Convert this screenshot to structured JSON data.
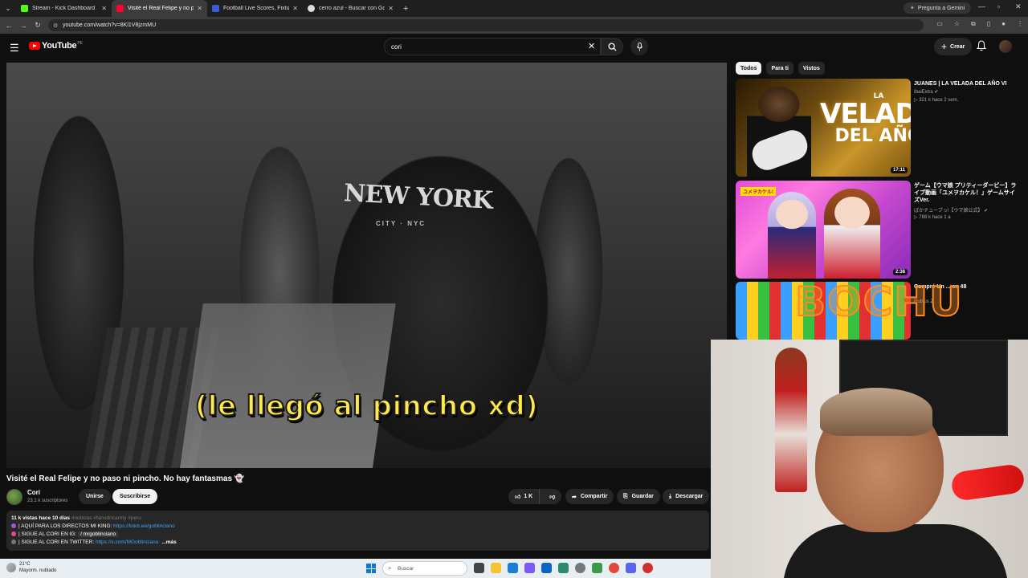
{
  "browser": {
    "tabs": [
      {
        "title": "Stream - Kick Dashboard",
        "favicon_color": "#53fc18",
        "active": false
      },
      {
        "title": "Visité el Real Felipe y no paso n",
        "favicon_color": "#ff0033",
        "active": true
      },
      {
        "title": "Football Live Scores, Fixtures &",
        "favicon_color": "#3b5bdb",
        "active": false
      },
      {
        "title": "cerro azul - Buscar con Google",
        "favicon_color": "#dddddd",
        "active": false
      }
    ],
    "gemini_label": "Pregunta a Gemini",
    "url": "youtube.com/watch?v=8Kl1V8jzmMU"
  },
  "youtube": {
    "logo_text": "YouTube",
    "country_code": "PE",
    "search_value": "cori",
    "create_label": "Crear"
  },
  "video": {
    "subtitle_overlay": "(le llegó al pincho xd)",
    "shirt_text": "NEW YORK",
    "shirt_subtext": "CITY · NYC",
    "title": "Visité el Real Felipe y no paso ni pincho. No hay fantasmas 👻",
    "channel": "Cori",
    "subscribers": "23.1 k suscriptores",
    "join_label": "Unirse",
    "subscribe_label": "Suscribirse",
    "likes": "1 K",
    "share_label": "Compartir",
    "save_label": "Guardar",
    "download_label": "Descargar",
    "description": {
      "meta": "11 k vistas  hace 10 días",
      "tags": "#noticias #fanodricarmy #peru",
      "line1_text": "| AQUÍ PARA LOS DIRECTOS MI KING: ",
      "line1_link": "https://linktr.ee/goblinciano",
      "line2_text": "| SIGUE AL CORI EN IG: ",
      "line2_chip": "/ mrgoblinciano",
      "line3_text": "| SIGUE AL CORI EN TWITTER: ",
      "line3_link": "https://x.com/MGoblinciano",
      "more_label": "...más"
    }
  },
  "sidebar": {
    "chips": [
      "Todos",
      "Para ti",
      "Vistos"
    ],
    "recommendations": [
      {
        "title": "JUANES | LA VELADA DEL AÑO VI",
        "channel": "IbaiExtra",
        "stats": "321 k  hace 2 sem.",
        "duration": "17:11",
        "thumb_text_top": "LA",
        "thumb_text_mid": "VELADA",
        "thumb_text_bot": "DEL AÑO"
      },
      {
        "title": "ゲーム【ウマ娘 プリティーダービー】ライブ動画「ユメヲカケル！」ゲームサイズVer.",
        "channel": "ぱかチューブっ!【ウマ娘公式】",
        "stats": "788 k  hace 1 a",
        "duration": "2:38",
        "thumb_banner": "ユメヲカケル!"
      },
      {
        "title": "Compré Un ... en 48",
        "channel": "Rubius Z",
        "stats": "",
        "duration": "",
        "overlay_text": "BOCHU"
      }
    ]
  },
  "taskbar": {
    "weather_temp": "21°C",
    "weather_desc": "Mayorm. nublado",
    "search_placeholder": "Buscar"
  }
}
